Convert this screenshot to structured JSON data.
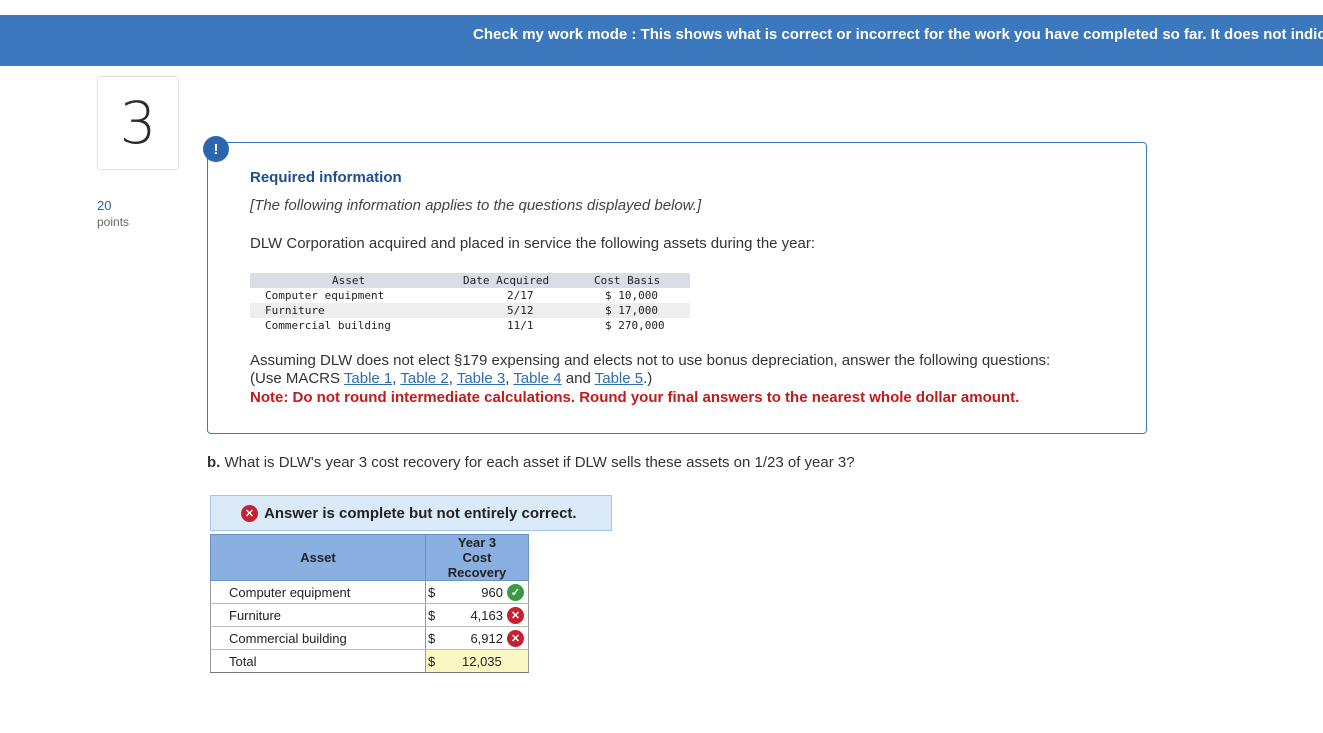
{
  "banner": {
    "text": "Check my work mode : This shows what is correct or incorrect for the work you have completed so far. It does not indic"
  },
  "question_number": "3",
  "points": {
    "value": "20",
    "label": "points"
  },
  "info": {
    "alert_icon": "!",
    "title": "Required information",
    "italic_note": "[The following information applies to the questions displayed below.]",
    "description": "DLW Corporation acquired and placed in service the following assets during the year:",
    "asset_table": {
      "headers": [
        "Asset",
        "Date Acquired",
        "Cost Basis"
      ],
      "rows": [
        [
          "Computer equipment",
          "2/17",
          "$ 10,000"
        ],
        [
          "Furniture",
          "5/12",
          "$ 17,000"
        ],
        [
          "Commercial building",
          "11/1",
          "$ 270,000"
        ]
      ]
    },
    "assumption": "Assuming DLW does not elect §179 expensing and elects not to use bonus depreciation, answer the following questions:",
    "use_prefix": "(Use MACRS ",
    "table_links": [
      "Table 1",
      "Table 2",
      "Table 3",
      "Table 4",
      "Table 5"
    ],
    "use_sep1": ", ",
    "use_sep2": ", ",
    "use_sep3": ", ",
    "use_and": " and ",
    "use_suffix": ".)",
    "note": "Note: Do not round intermediate calculations. Round your final answers to the nearest whole dollar amount."
  },
  "question": {
    "prefix": "b.",
    "text": " What is DLW's year 3 cost recovery for each asset if DLW sells these assets on 1/23 of year 3?"
  },
  "status": {
    "icon": "x-circle-icon",
    "text": "Answer is complete but not entirely correct."
  },
  "answer_table": {
    "header_asset": "Asset",
    "header_recovery_lines": [
      "Year 3",
      "Cost",
      "Recovery"
    ],
    "rows": [
      {
        "asset": "Computer equipment",
        "currency": "$",
        "value": "960",
        "status": "correct"
      },
      {
        "asset": "Furniture",
        "currency": "$",
        "value": "4,163",
        "status": "incorrect"
      },
      {
        "asset": "Commercial building",
        "currency": "$",
        "value": "6,912",
        "status": "incorrect"
      }
    ],
    "total": {
      "label": "Total",
      "currency": "$",
      "value": "12,035"
    }
  },
  "colors": {
    "banner": "#3b78bd",
    "correct": "#3a9a46",
    "incorrect": "#c8202f",
    "note": "#c41a1a"
  }
}
